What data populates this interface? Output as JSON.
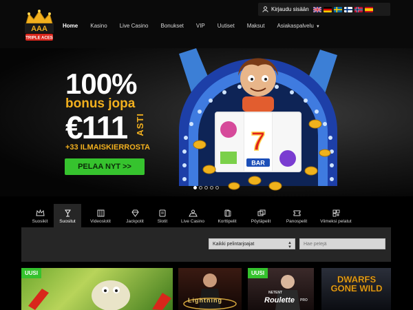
{
  "brand": {
    "name": "TRIPLE ACES"
  },
  "topbar": {
    "login_label": "Kirjaudu sisään",
    "languages": [
      "en",
      "de",
      "sv",
      "fi",
      "no",
      "es"
    ]
  },
  "nav": {
    "items": [
      "Home",
      "Kasino",
      "Live Casino",
      "Bonukset",
      "VIP",
      "Uutiset",
      "Maksut",
      "Asiakaspalvelu"
    ]
  },
  "hero": {
    "headline": "100%",
    "subline": "bonus jopa",
    "amount": "€111",
    "amount_suffix": "ASTI",
    "spins": "+33 ILMAISKIERROSTA",
    "cta_label": "PELAA NYT >>",
    "slider_count": 5,
    "slider_active": 1,
    "slot_symbol": "7",
    "slot_bar": "BAR"
  },
  "categories": {
    "items": [
      "Suosikit",
      "Suositut",
      "Videoslotit",
      "Jackpotit",
      "Slotit",
      "Live Casino",
      "Korttipelit",
      "Pöytäpelit",
      "Panospelit",
      "Viimeksi pelatut"
    ],
    "active": "Suositut"
  },
  "filter": {
    "provider_select": "Kaikki pelintarjoajat",
    "search_placeholder": "Hae pelejä"
  },
  "games": {
    "new_badge": "UUSI",
    "tiles": [
      {
        "title": "",
        "badge": true
      },
      {
        "title": "Lightning",
        "badge": false
      },
      {
        "title": "Roulette",
        "provider": "NETENT",
        "suffix": "PRO",
        "badge": true
      },
      {
        "title": "DWARFS GONE WILD",
        "badge": false
      }
    ]
  },
  "colors": {
    "accent_green": "#36c32e",
    "promo_gold": "#f2b01e",
    "panel": "#262626",
    "background": "#000000"
  }
}
